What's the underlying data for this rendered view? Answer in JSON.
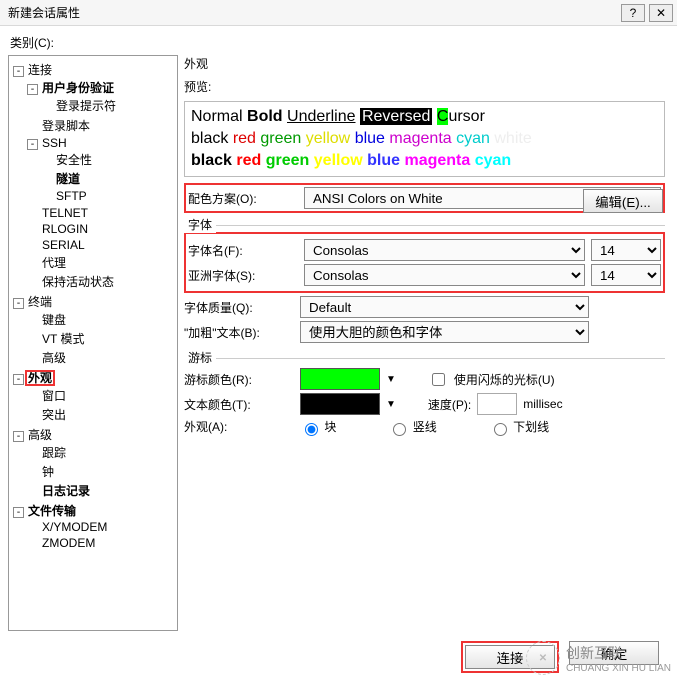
{
  "title": "新建会话属性",
  "titlebar": {
    "help": "?",
    "close": "✕"
  },
  "category_label": "类别(C):",
  "tree": {
    "connection": "连接",
    "user_auth": "用户身份验证",
    "login_prompt": "登录提示符",
    "login_script": "登录脚本",
    "ssh": "SSH",
    "security": "安全性",
    "tunnel": "隧道",
    "sftp": "SFTP",
    "telnet": "TELNET",
    "rlogin": "RLOGIN",
    "serial": "SERIAL",
    "proxy": "代理",
    "keepalive": "保持活动状态",
    "terminal": "终端",
    "keyboard": "键盘",
    "vt_mode": "VT 模式",
    "advanced1": "高级",
    "appearance": "外观",
    "window": "窗口",
    "highlight": "突出",
    "advanced2": "高级",
    "tracking": "跟踪",
    "bell": "钟",
    "logging": "日志记录",
    "file_transfer": "文件传输",
    "xymodem": "X/YMODEM",
    "zmodem": "ZMODEM"
  },
  "content": {
    "section_appearance": "外观",
    "preview_label": "预览:",
    "preview": {
      "normal": "Normal",
      "bold": "Bold",
      "underline": "Underline",
      "reversed": "Reversed",
      "cursorC": "C",
      "cursorRest": "ursor",
      "row_labels": [
        "black",
        "red",
        "green",
        "yellow",
        "blue",
        "magenta",
        "cyan",
        "white"
      ]
    },
    "scheme_label": "配色方案(O):",
    "scheme_value": "ANSI Colors on White",
    "edit_btn": "编辑(E)...",
    "font_group": "字体",
    "font_name_label": "字体名(F):",
    "font_name_value": "Consolas",
    "font_size1": "14",
    "asian_font_label": "亚洲字体(S):",
    "asian_font_value": "Consolas",
    "font_size2": "14",
    "font_quality_label": "字体质量(Q):",
    "font_quality_value": "Default",
    "bold_text_label": "\"加粗\"文本(B):",
    "bold_text_value": "使用大胆的颜色和字体",
    "cursor_group": "游标",
    "cursor_color_label": "游标颜色(R):",
    "blink_label": "使用闪烁的光标(U)",
    "text_color_label": "文本颜色(T):",
    "speed_label": "速度(P):",
    "millisec": "millisec",
    "appearance_label": "外观(A):",
    "radio_block": "块",
    "radio_vline": "竖线",
    "radio_under": "下划线"
  },
  "footer": {
    "connect": "连接",
    "ok": "确定"
  },
  "watermark": {
    "brand": "创新互联",
    "sub": "CHUANG XIN HU LIAN"
  }
}
